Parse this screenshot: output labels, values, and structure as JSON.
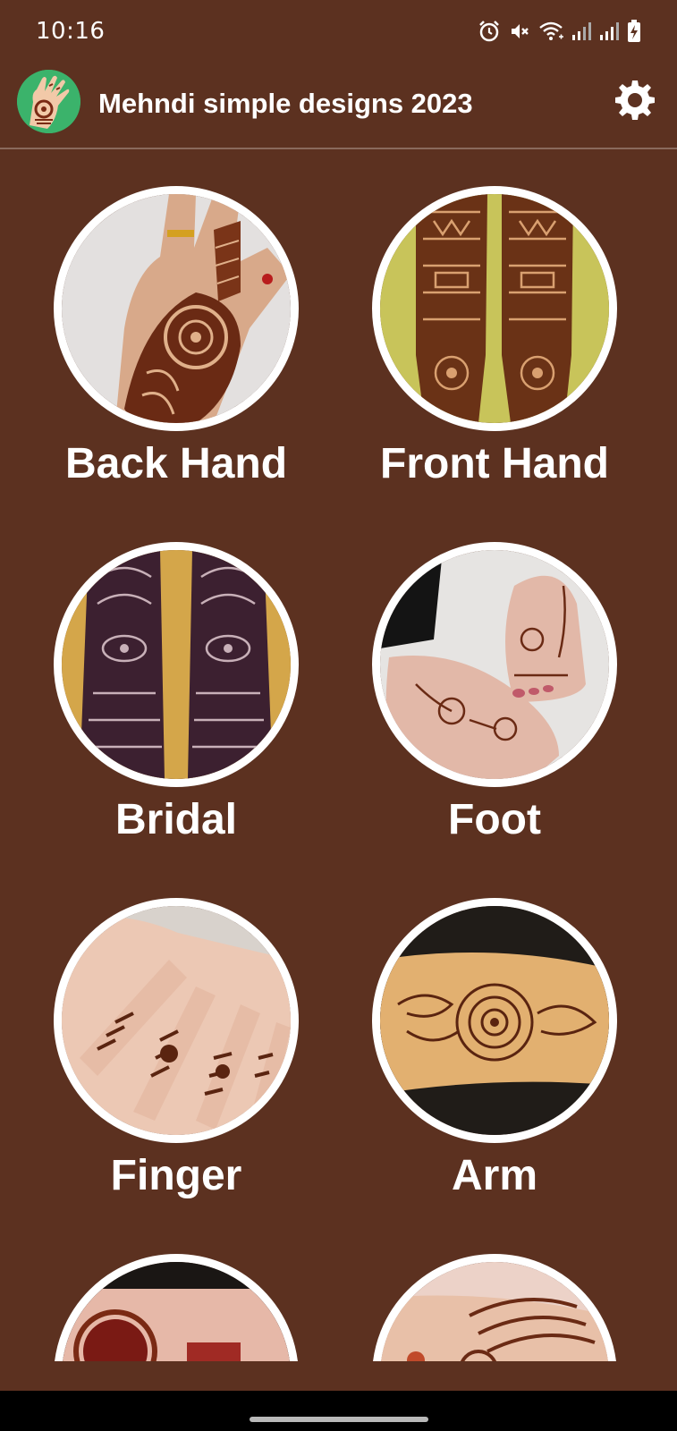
{
  "status_bar": {
    "time": "10:16",
    "icons": [
      "alarm-icon",
      "mute-icon",
      "wifi-icon",
      "signal-icon",
      "signal-icon",
      "battery-charging-icon"
    ]
  },
  "app_bar": {
    "title": "Mehndi simple designs 2023",
    "logo_icon": "henna-hand-logo",
    "settings_icon": "gear-icon"
  },
  "categories": [
    {
      "label": "Back Hand",
      "image": "back-hand-mehndi-photo"
    },
    {
      "label": "Front Hand",
      "image": "front-hand-mehndi-photo"
    },
    {
      "label": "Bridal",
      "image": "bridal-mehndi-photo"
    },
    {
      "label": "Foot",
      "image": "foot-mehndi-photo"
    },
    {
      "label": "Finger",
      "image": "finger-mehndi-photo"
    },
    {
      "label": "Arm",
      "image": "arm-mehndi-photo"
    },
    {
      "label": "",
      "image": "round-tikki-mehndi-photo"
    },
    {
      "label": "",
      "image": "jewellery-mehndi-photo"
    }
  ],
  "colors": {
    "background": "#5c3120",
    "label_text": "#ffffff",
    "thumb_border": "#ffffff",
    "logo_bg": "#3bb36b"
  }
}
